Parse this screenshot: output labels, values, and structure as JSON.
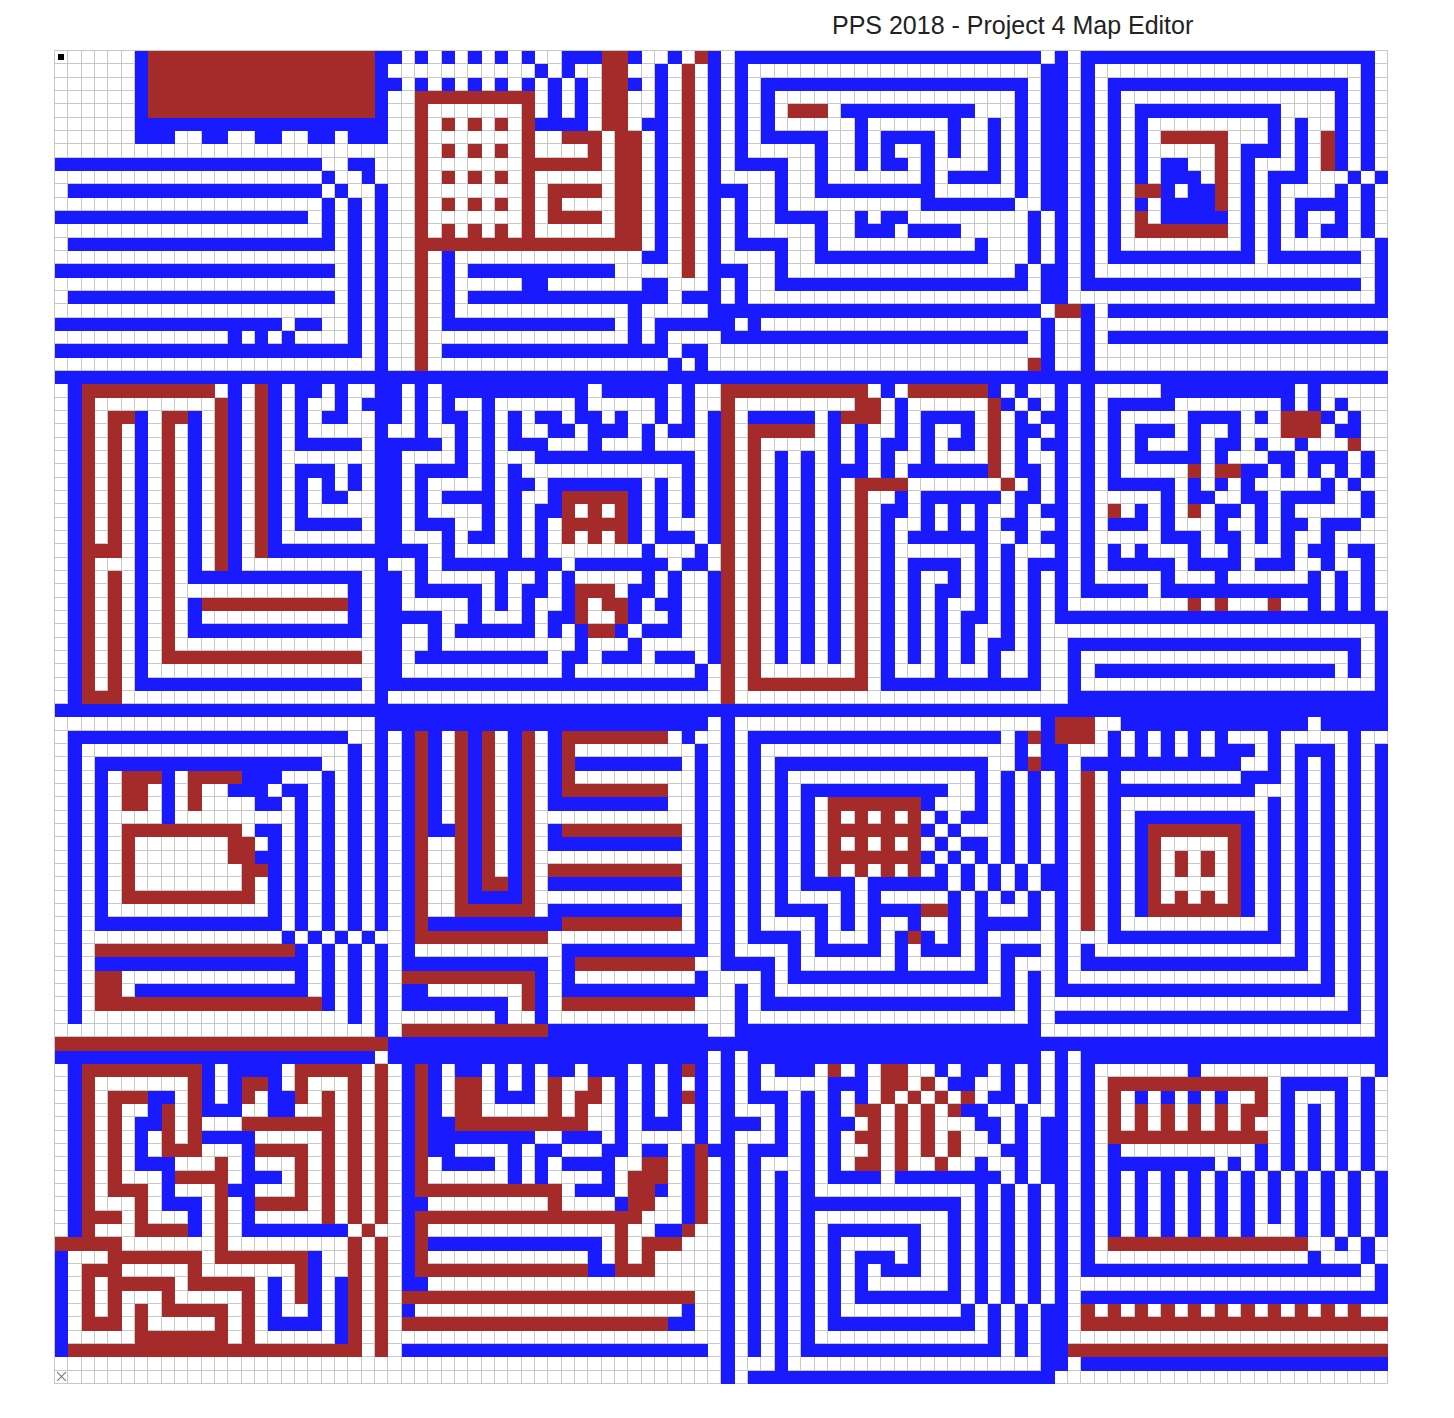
{
  "window": {
    "title": "PPS 2018 - Project 4 Map Editor"
  },
  "map": {
    "legend": {
      ".": {
        "kind": "empty",
        "color": "#ffffff"
      },
      "B": {
        "kind": "blue",
        "color": "#1a1aff"
      },
      "R": {
        "kind": "red",
        "color": "#a52a2a"
      },
      "S": {
        "kind": "start",
        "color": "#ffffff"
      },
      "X": {
        "kind": "end",
        "color": "#ffffff"
      }
    },
    "rows": [
      "S.....BRRRRRRRRRRRRRRRRRB|B.B.B.B.B.B..BBBRRB..B.RB|.BBBBBBBBBBBBBBBBBBBBBBB.|B.BBBBBBBBBBBBBBBBBBBBBB.",
      "......BRRRRRRRRRRRRRRRRRB|...........B.B..RR..B.R.B|.B......................B|B.B....................B.",
      "......BRRRRRRRRRRRRRRRRRB|B.B.B.B.B.B.B.B.RRB.B.R.B|.B.BBBBBBBBBBBBBBBBBBBB.B|B.B.BBBBBBBBBBBBBBBBBB.B.",
      "......BRRRRRRRRRRRRRRRRRB|..RRRRRRRRR.B.B.RR..B.R.B|.B.B..................B.B|B.B.B................B.B.",
      "......BRRRRRRRRRRRRRRRRRB|..R.......R.B.B.RR..B.R.B|.B.B.RRR.BBBBBBBBBB...B.B|B.B.B.BBBBBBBBBBB....B.B.",
      "......BBBBBBBBBBBBBBBBBBB|..R.R.R.R.RBBBB.RR.BB.R.B|.B.B......B......B..B.B.B|B.B.B.B.........B.B..B.B.",
      "......BBB..BB..BB..BB.BBB|..R.......R..RRR.RR.B.R.B|.B.BBBBB..B.BBBB.B..B.B.B|B.B.B.B.RRRRR...B.B.RB.B.",
      ".........................|..R.R.R.R.R....R.RR.B.R.B|.B.....B..B.B..B.B..B.B.B|B.B.B.B.....R.BBB.B.RB.B.",
      "BBBBBBBBBBBBBBBBBBBB..BB.|..R.......RRRRRR.RR.B.R.B|.BBBB..B..B.BB.B....B.B.B|B.B.B.B.BB..R.B...B.RB.B.",
      "....................B..B.|..R.R.R.R.R......RR.B.R.B|....B..B.......B.BBBB.B.B|B.B.B.B.BBB.R.B.BBB...B.B",
      ".BBBBBBBBBBBBBBBBBBB.B..B|..R.......R.RRRR.RR.B.R.B|BB..B..BBBBBBBBB......B.B|B.B.B.RRB.BBR.B.B....B.B.",
      "....................B.B.B|..R.R.R.R.R.R....RR.B.R.B|.B..B..........BBBBBBB..B|B.B.B.B.BBBBR.B.B.BBBB.B.",
      "BBBBBBBBBBBBBBBBBBB.B.B.B|..R.......R.RRRR.RR.B.R.B|.B..BBBB..B.BB.........B.B|B.B.B.R.BBBBB.B.B.B..B.B.",
      "....................B.B.B|..R.R.R.R.R......RR.B.R.B|.B.....B..BBB.BBBB.....B.B|B.B.B.RRRRRRR.B.B.B.BB.B.",
      ".BBBBBBBBBBBBBBBBBBBB.B.B|..RRRRRRRRRRRRRRRRR.B.R.B|.BBBB..B...........B...B.B|B.B.B.........B.B.......B",
      "......................B.B|..R.B..............BB.R.B|....B..BBBBBBBBBBBBB...B.B|B.B.BBBBBBBBBBB.BBBBBBB.B",
      "BBBBBBBBBBBBBBBBBBBBB.B.B|..R.B.BBBBBBBBBBB.....R.B|BB..B.................B.B.|B.B.....................B",
      "......................B.B|..R.B.....BB.......BB...B|.B..BBBBBBBBBBBBBBBBBBB.B.|B.BBBBBBBBBBBBBBBBBBBBB.B",
      ".BBBBBBBBBBBBBBBBBBBB.B.B|..R.B.BBBBBBBBBBBBBBB.BBB|.B......................B|B.......................B",
      "......................B.B|..R.B.............B.....B|BBBBBBBBBBBBBBBBBBBBBBBB.B|RRB.BBBBBBBBBBBBBBBBBBBBB",
      "BBBBBBBBBBBBBBBBB.BB..B.B|..R.BBBBBBBBBBBBB.B.BBBBB|B.B.....................B|..B......................",
      ".............B.B.B....B.B|..R...............B.B....|BBBBBBBBBBBBBBBBBBBBBBB.B|..B.BBBBBBBBBBBBBBBBBBBBB",
      "BBBBBBBBBBBBBBBBBBBBBBB.B|..R.BBBBBBBBBBBBBBBBB.BB.|........................B|..B......................",
      "........................B|..R..................B.B.|.......................RB|..B......................",
      "BBBBBBBBBBBBBBBBBBBBBBBBBB|BBBBBBBBBBBBBBBBBBBBBBBBBB|BBBBBBBBBBBBBBBBBBBBBBBBBB|BBBBBBBBBBBBBBBBBBBBBBBBBB",
      ".BRRRRRRRRRR.B.RB.BB.B..B|B.B.BBBBBBBBBBB.BBBBB.B..|RRRRRRRRRRR.B.RRRRRRB.B..|B.B.....BBBBBBBBBB.B.....",
      ".BR.........RB.RB.B..B.BB|B.B.B..B......B.....B.B..|R.........RR.B......RB.B.|B.B.BBBBB........B.B.B...",
      ".BR.RRB.RRB.RB.RB.B.BB..B|B.B.BB.B.B.BB.BB.B..B.B.B|R.BBBBB.BRRR.B.BBBB.R.B.B|B.B.B.....BBBB.B.RRRB.B..",
      ".BR.R.B.R.B.RB.RB.B.....B|..B..B.B.B..BB.BBB.B.BB.B|R.RRRRR.B.B..B.B..B.R.BB.|B.B.B.BBB.B..B...RRR.BB..",
      ".BR.R.B.R.B.RB.RB.BBBBB.B|BBBB.B.B.BBB...B...B....B|R.R.....B.B.BB.B.BB.R.B.B|B.B.B.B...B.BB.B..B...R..",
      ".BR.R.B.R.B.RB.RB.......B|B....B.B...BBBBBBBBBBBB.B|R.R.B.B.B.B.B..B....R.B..|B.B.B.BBBBB.B...BB.BBB.B.",
      ".BR.R.B.R.B.RB.RB.BBB.B.B|B.BBBB.B.B............B.B|R.R.B.B.BBB.B.BBBBBBR.BB.|B.B.B.....R.RRBB.B.B.B.B.",
      ".BR.R.B.R.B.RB.RB.B.B.B.B|B.B....B.BB.BBBBBBB.B.B.B|R.R.B.B.B.RRRR.......R.B.|B.B.BBBBB.B.B.B.....B.B..",
      ".BR.R.B.R.B.RB.RB.B.BB..B|B.B.BBBB.B..BRRRRRB.B.B.B|R.R.B.B.B.R..B.BBBBBB.BB.|B.B.....B.BB..BB.BBBB..B.",
      ".BR.R.B.R.B.RB.RB.B.....B|B.B....B.B.BBR.R.RB.B.B.B|R.R.B.B.B.R.BB.B.B.B..B.B|B.B.R.B.B.R.BB.B.B.....B.",
      ".BR.R.B.R.B.RB.RB.BBBBB.B|B.BBB..B.B.B.RRRRRB.B...B|R.R.B.B.B.R.B..B.B.B.BB..|B.B.BBB.B...B..B.BB.BBB..",
      ".BR.R.B.R.B.RB.RB.......B|B...B.BB.B.B.R.R.RB.BBB.B|R.R.B.B.B.R.B.BBBBBB..B.B|B.B.....BBB.BB.B.B..B....",
      ".BRRR.B.R.B.RB.RBBBBBBBBB|BBB.B....B.B.......B...B.B|R.R.B.B.B.R.B......B.B...|B.B.B.B...B..B...B.BB.BB.",
      ".BR...B.R.B.RB..........B|..B.BBBBBBBBB.BBBBBBB.BB.B|R.R.B.B.B.R.B.BBBB.B.B.BB|B.B.BBBBB.BBBB.BBB..B..B.",
      ".BR.R.B.R.BBBBBBBBBBBBB.B|B.B.....B..B.B.....B.B..B|R.R.B.B.B.R.B.B..B.B.B.B.|B.B.....B...B......B.B.B.",
      ".BR.R.B.R.............B.B|B.BBBBB.B.BB.BRRR.BB.B..B|R.R.B.B.B.R.B.B.BB.B.B.B.|B.BBBBB.BBBBBBBBBBBB.B.B.",
      ".BR.R.B.R.BRRRRRRRRRRRB.B|B.....B.B.B..BR.RRB.BB..B|R.R.B.B.B.R.B.B.B..B.B.B.|B.........R.R...R..B.B.B.",
      ".BR.R.B.R.B...........B.B|BBBB..B...B.BBR..RB..B..B|R.R.B.B.B.R.B.B.B.BB.B.B.|BBBBBBBBBBBBBBBBBBBBBBBBBB",
      ".BR.R.B.R.BBBBBBBBBBBBB.B|B..B.BBBBBB.B.BRRB.BBB..B|R.R.B.B.B.R.B.B.B.B..B.B.|........................B",
      ".BR.R.B.R...............B|B..B..........B...B.....B|R.R.B.B.B.R.B.B.B.B.BB.B.|.BBBBBBBBBBBBBBBBBBBBBB.B",
      ".BR.R.B.RRRRRRRRRRRRRRR.B|B.BBBBBBBBBB.BB.BBB.BBB.B|R.R.B.B.B.R.B.B.B.B.B..B.|.B....................B.B",
      ".BR.R.B.................B|B............B.........B.|R.R.......R.B...B...B..B.|.B.BBBBBBBBBBBBBBBBBB.B.B",
      ".BR.R.BBBBBBBBBBBBBBBBB.B|BBBBBBBBBBBBBBBBBBBBBBBB.|R.RRRRRRRRR.BBBBBBBBBBBB.|.B......................B",
      ".BRRR...................B|.........................|R........................|.BBBBBBBBBBBBBBBBBBBBBBBBB",
      "BBBBBBBBBBBBBBBBBBBBBBBBBB|BBBBBBBBBBBBBBBBBBBBBBBBBB|BBBBBBBBBBBBBBBBBBBBBBBBBB|BBBBBBBBBBBBBBBBBBBBBBBBBB",
      "........................B|BBBBBBBBBBBBBBBBBBBBBBBB.|B.......................B|RRR..BBBBBBBBBBBBBB.BBBBB",
      ".BBBBBBBBBBBBBBBBBBBBB..B|.BRB.RBR.BR.BRRRRRRRR.B..|B.BBBBBBBBBBBBBBBBBBB.BRB|RRR.B.B.B.B.B...B.....B..",
      ".B....................B.B|.BRB.RBR.BR.BR.........B.|B.B...................B.B|B...B.B.B.B.BBB.B.BBB.B.B",
      ".B.BBBBBBBBBBBBBBBBB..B.B|.BRB.RBR.BR.BRBBBBBBBB.B.|B.B.BBBBBBBBBBBBBBBB..BRB|B.BBBBBBBBBBBB..B.B.B.B.B",
      ".B.B.RRRB.RRRRBBB...B.B.B|.BRB.RBR.BR.BR.........B.|B.B.B..............B.B.B.|B.R.B.........BBB.B.B.B.B",
      ".B.B.RR.B.R..BBB.BB.B.B.B|.BRB.RBR.BR.BRRRRRRRR..B.|B.B.B.BBBBBBBBBBB..B.B.B.|B.R.BBBBBBBBBBB...B.B.B.B",
      ".B.B.RR.B.R....BB.B.B.B.B|.BRB.RBR.BR.BBBBBBBBB..B.|B.B.B.B.RRRRRRRB...B.B.B.|B.R.B...........B.B.B.B.B",
      ".B.B....B.........B.B.B.B|.BRB.RBR.BR............B.|B.B.B.B.R.R.R.R.B.BB.B.B.|B.R.B.BBBBBBBBB.B.B.B.B.B",
      ".B.B.RRRRRRRRR.BB.B.B.B.B|.BRBBRBR.BR.BRRRRRRRRR.B.|B.B.B.B.RRRRRRRB.B...B.B.|B.R.B.BRRRRRRRB.B.B.B.B.B",
      ".B.B.R.......RR.B.B.B.B.B|.BR..RBR.BR.BBBBBBBBBB.B.|B.B.B.B.R.R.R.R.B.BB.B.B.|B.R.B.BR.....RB.B.B.B.B.B",
      ".B.B.R.......RRBB.B.B.B.B|.BR..RBR.BR............B.|B.B.B.B.RRRRRRRB.B.B.B.B.|B.R.B.BR.R.R.RB.B.B.B.B.B",
      ".B.B.R........RRB.B.B.B.B|.BR..RBR.BR.RRRRRRRRRR.B.|B.B.B.B.R.R.R.R.B.B.B.B.B|B.R.B.BR.R.R.RB.B.B.B.B.B",
      ".B.B.R........R.B.B.B.B.B|.BR..RBRRBR.BBBBBBBBBB.B.|B.B.B.BBBB.BBBBBB.B.B.B.B|B.R.B.BR.....RB.B.B.B.B.B",
      ".B.B.RRRRRRRRRR.B.B.B.B.B|.BR..RBBBBR............B.|B.B.B....B.B.....B.B.B.B.|B.R.B.BR.R.R.RB.B.B.B.B.B",
      ".B.B............B.B.B.B.B|.BR..RRRRRR.BBBBBBBBBB.B.|B.B.BBBB.B.BBBBRRB.B...B.|B.R.B.BRRRRRRRB.B.B.B.B.B",
      ".B.BBBBBBBBBBBBBB.B.B.B.B|.BRBBBBBBBBBBRRRRRRRRR.B.|B.B....B.B.B..B..B.BBBBB.|B.R.B...........B.B.B.B.B",
      ".B...............B.B.B.B.|.BRRRRRRRRRR...........B.|B.BBBB.B...B.BRB.B.B.....|B...BBBBBBBBBBBBB.B.B.B.B",
      ".B.RRRRRRRRRRRRRRRB.B.B.B|.B...........BBBBBBBBBBB.|B....B.BBBBB.B.BBB.B.BBB.|B.B...............B.B.B.B",
      ".B.BBBBBBBBBBBBBBBB.B.B.B|.BBBBBBBBBBB.BRRRRRRRRR..|BBBB.B.......B.....B.B...|B.BBBBBBBBBBBBBBBBB.B.B.B",
      ".B.RR.............B.B.B.B|.RRRRRRRRRRB.B.........B.|...B.BBBBBBBBBBBBBBB.B.B.|B...................B.B.B",
      ".B.RR.BBBBBBBBBBBBB.B.B.B|.BB.......RB.BBBBBBBBBBB.|.B.B.................B.B.|BBBBBBBBBBBBBBBBBBBBB.B.B",
      ".B.RRRRRRRRRRRRRRRRRB.B.B|.BBBBBBBB.RB.RRRRRRRRRR..|.B.BBBBBBBBBBBBBBBBBBB.B.|......................B.B",
      ".B....................B.B|........B..B.............|.B.....................B.|BBBBBBBBBBBBBBBBBBBBBBB.B",
      "........................B|.RRRRRRRRRRRBBBBBBBBBBBB.|.BBBBBBBBBBBBBBBBBBBBBBB.|........................B",
      "RRRRRRRRRRRRRRRRRRRRRRRRRR|BBBBBBBBBBBBBBBBBBBBBBBBBB|BBBBBBBBBBBBBBBBBBBBBBBBBB|BBBBBBBBBBBBBBBBBBBBBBBBBB",
      "BBBBBBBBBBBBBBBBBBBBBBBB.|BBBBBBBBBBBBBBBBBBBBBBBB.|B.BBBBBBBBBBBBBBBBBBBBBB.|B.BBBBBBBBBBBBBBBBBBBBBBBB",
      ".BRRRRRRRRRB.BBBB.RRRRR.R|.BRB.BB.B.B.BB.BBB.B.BRB.|B.B.BBB.R.B.RR..B.BB.B.B.|B.B.......B.............B",
      ".BR.......RB.BRRB.R...R.R|.BRB.RR.B.B.R..R.B.B.B.B.|B.B.....BBB.RR.R.BB..B.B.|B.B.RRRRRRRRRRRR.BBBBB.B.",
      ".BR.RRRBB.RB.BR.BBR.R.R.R|.BRB.RR.BBB.R.RR.B.B.BRB.|B.BBB.B.B.B.R.R.R.R.BB.B.|B.B.R.B.B.B.B..R.B...B.B.",
      ".BR.R..BR.RBBB..BB..R.R.R|.BRB.RR.....R.R..B.B.B.B.|B...B.B.B.RR.R.R.RBB..B..|B.B.R.R.R.R.R.RR.B.B.B.B.",
      ".BR.R.BBR.R...RRRRRRR.R.R|.BRBBRRRRRRRRRR..B.BBB.B.|BBB.B.B.BB.R.R.R...BB.B.B|B.B.R.R.R.R.R.R..B.B.B.B.",
      ".BR.R.B.R.RBBBB.....R.R.R|.BRBBBBBBBB..BBB.B.....B.|B...B.B.B.RR.R.R.R..B.B.B|B.B.RRRRRRRRRRRR.B.B.B.B.",
      ".BR.R.B.RRR...BRRRR.R.R.R|.BRBB....B.BB...BB.BB.BRB|B.BBB.B.B..R.R.R.R...BB.B|B.B.B..........B.B.B.B.B.",
      ".BR.R.BBB...R.B...R.R.R.R|.BR.BBBB.B.B.BBBB..RR.BR.|B.B...B.B.RR.R..R..B..B.B|B.B.BBBBBBBB.B.B.B.B.B.B.",
      ".BR.R...BRRRR.BBB.R.R.R.R|.BR......B.B....B.RRR.BR.|B.B.B.B.BBBB.BBBBBBBB.B.B|B.B.B.B.B.B.B.B.B.B.B.B.B",
      ".BR.RRR.B...RBB...R.R.R.R|.BRRRRRRRRRRR.BBB.RRB.BR.|B.B.B.B............B.B.B.|B.B.B.B.B.B.B.B.B.B.B.B.B",
      ".BR...R.BBB.R.BRRRR.R.R.R|.BB.........R....BRR..BR.|B.B.B.BBBBBBBBBBBB.B.B.B.|B.B.B.B.B.B.B.B.B.B.B.B.B",
      ".BRRR.R...B.R.B.....R.R.R|.BRRRRRRRRRRRRRRRRR...BR.|B.B.B.B..........B.B.B.B.|B.B.B.B.B.B.B.B.B.B.B.B.B",
      ".BR...RRRRB.R.BBBBBBBB.R.|.BR..............R..BBR..|B.B.B.B.BBBBBBB..B.B.B.B.|B.B.B.B.B.B.B.B...B.B.B.B",
      "RRRRR.......R.........R.R|.BRBBBBBBBBBBBBB.R.RRR...|B.B.B.B.B.....B..B.B.B.B.|B.B.RRRRRRRRRRRRRRR..B.B.",
      "B...RRRRRRR.RRRRRRRB..R.R|.BR............B.R.R.....|B.B.B.B.B.BBB.B..B.B.B.B.|B.B................B...B.",
      "B.RRR.....R.......RB..R.R|.BRRRRRRRRRRRRRBBRRR.....|B.B.B.B.B.B.BBB..B.B.B.B.|B.BBBBBBBBBBBBBBBBBBBBB.B",
      "B.R.RRRRR.RRRRR.B.RB.BR.R|.BB......................|B.B.B.B.B.B......B.B.B.B.|B.......................B",
      "B.R.R...R.....R.B.RB.BR.R|.RRRRRRRRRRRRRRRRRRRRRR..|B.B.B.B.B.BBBBBBBB.B.B.B.|B.BBBBBBBBBBBBBBBBBBBBBBB",
      "B.R.R.R.RRRRR.R.B..B.BR.R|.B....................B..|B.B.B.B.B.........B.B.B.B|B.R.R.R.R.R.R.R.R.R.R.R..",
      "B.RRR.R.....R.R.BBBB.BR.R|.RRRRRRRRRRRRRRRRRRRRBB..|B.B.B.B.BBBBBBBBBBB.B.B.B|B.RRRRRRRRRRRRRRRRRRRRRRR",
      "B.....RRRRRRR.R......BR.R|.........................|B.B.B.B.............B.B.B|B........................",
      "BRRRRRRRRRRRRRRRRRRRRRR.R|.BBBBBBBBBBBBBBBBBBBBBBB.|B.B.B.BBBBBBBBBBBBBBB.B.B|BRRRRRRRRRRRRRRRRRRRRRRRR",
      ".........................|.........................|B...B...................B|B.BBBBBBBBBBBBBBBBBBBBBBB",
      "X........................|.........................|B.BBBBBBBBBBBBBBBBBBBBBBB|........................."
    ]
  }
}
